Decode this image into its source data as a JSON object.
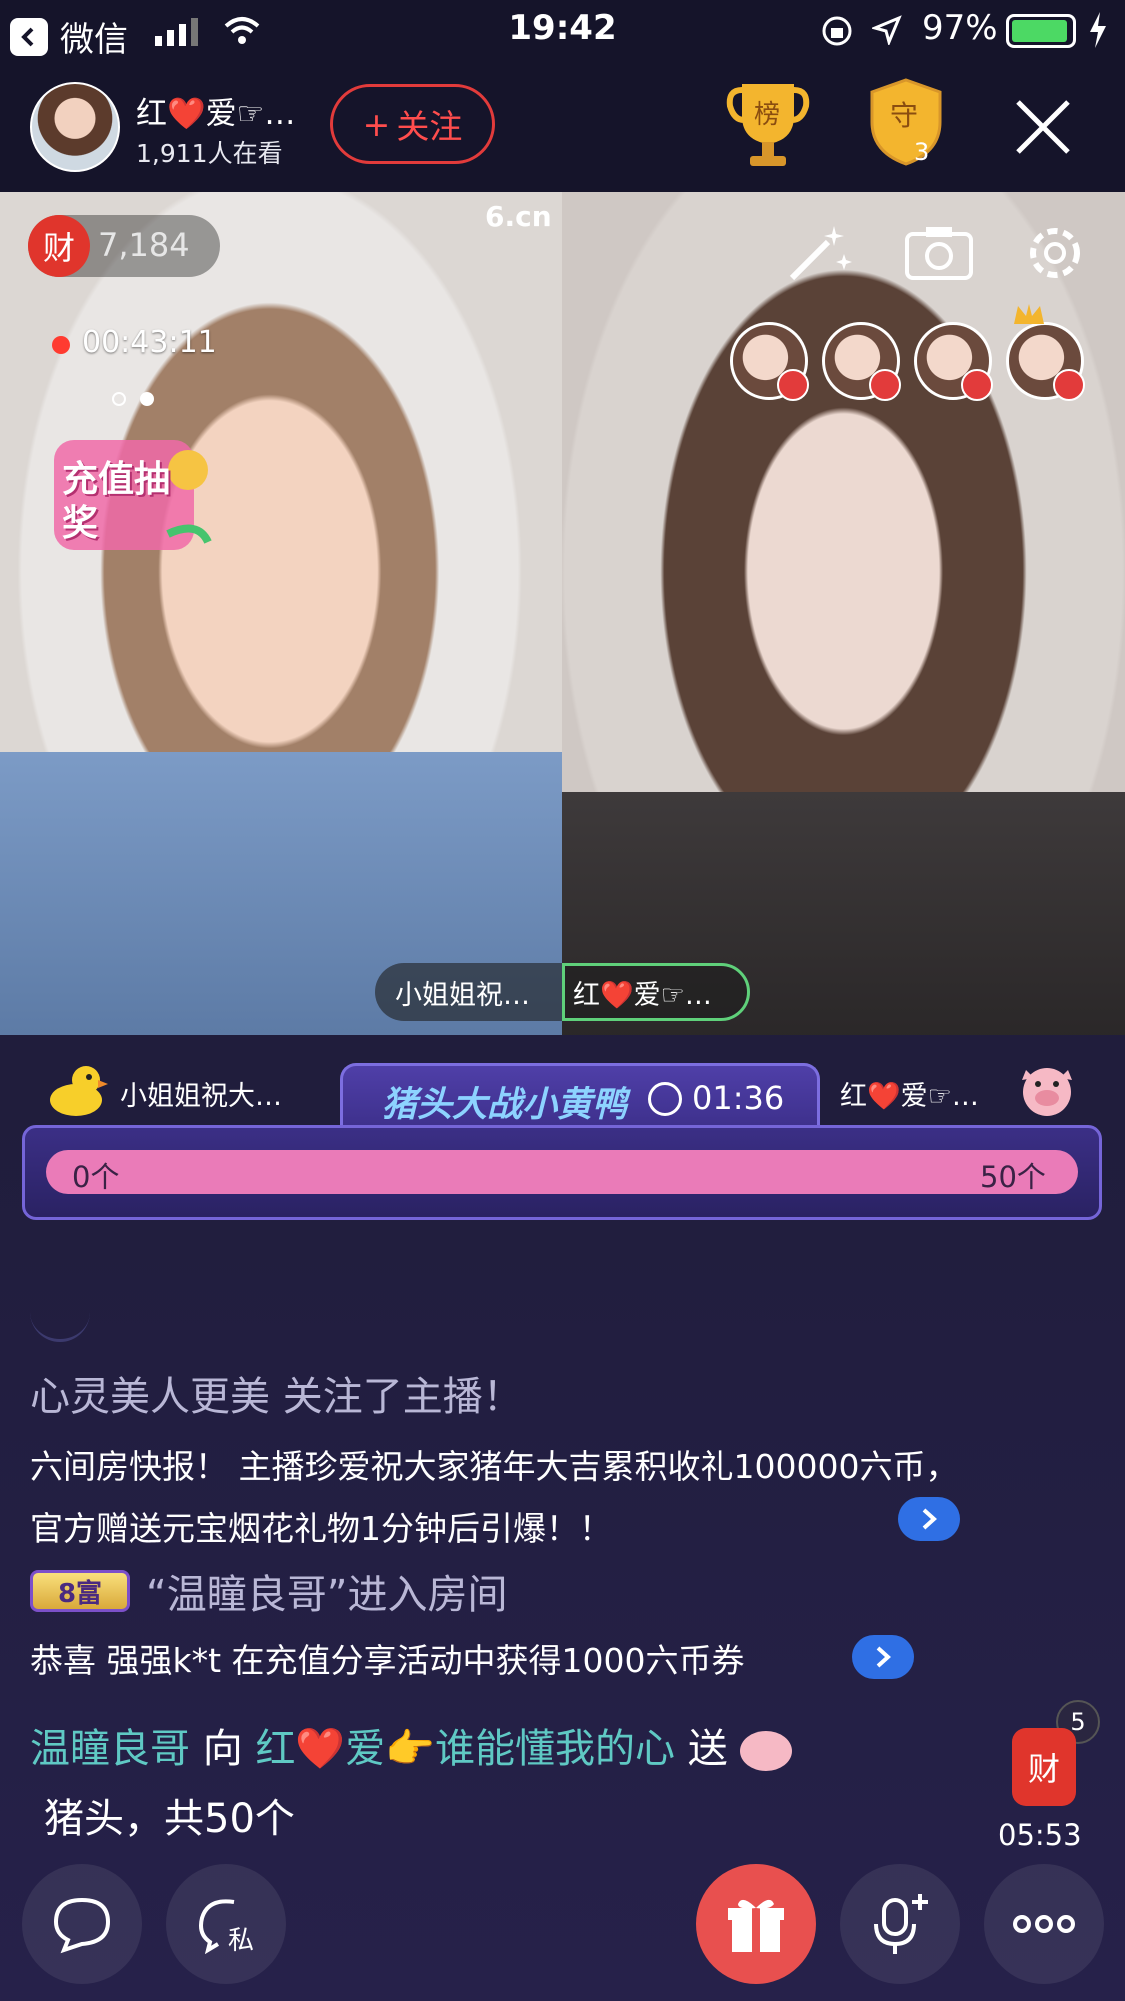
{
  "status_bar": {
    "back_app": "微信",
    "time": "19:42",
    "battery": "97%"
  },
  "header": {
    "host_name": "红❤️爱☞…",
    "viewers": "1,911人在看",
    "follow_label": "关注",
    "rank_label": "榜",
    "guard_label": "守",
    "guard_count": "3"
  },
  "video": {
    "wealth_label": "财",
    "wealth_count": "7,184",
    "record_time": "00:43:11",
    "promo_text": "充值抽奖",
    "watermark": "6.cn",
    "left_name": "小姐姐祝…",
    "right_name": "红❤️爱☞…"
  },
  "pk": {
    "left_name": "小姐姐祝大…",
    "right_name": "红❤️爱☞…",
    "title": "猪头大战小黄鸭",
    "timer": "01:36",
    "left_count": "0个",
    "right_count": "50个"
  },
  "chat": {
    "line1": "心灵美人更美 关注了主播！",
    "line2": "六间房快报！ 主播珍爱祝大家猪年大吉累积收礼100000六币，官方赠送元宝烟花礼物1分钟后引爆！！",
    "rich_badge": "8富",
    "line3": "“温瞳良哥”进入房间",
    "line4": "恭喜 强强k*t 在充值分享活动中获得1000六币券",
    "gift_sender": "温瞳良哥",
    "gift_to": "向",
    "gift_receiver": "红❤️爱👉谁能懂我的心",
    "gift_send": "送",
    "gift_item": "猪头，共50个"
  },
  "wealth_widget": {
    "label": "财",
    "count": "5",
    "timer": "05:53"
  },
  "toolbar": {
    "private_label": "私"
  },
  "colors": {
    "accent_red": "#e23b3b",
    "pk_bar_pink": "#ea7bb8",
    "username_teal": "#5fc9c4",
    "link_blue": "#2f6fe4"
  }
}
